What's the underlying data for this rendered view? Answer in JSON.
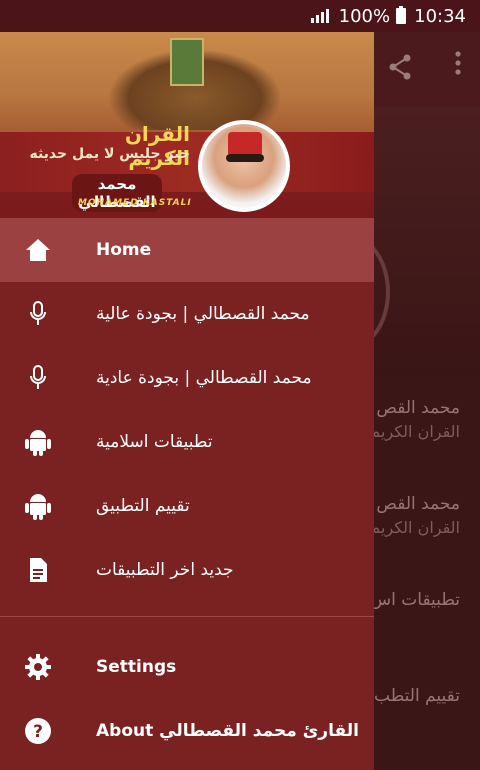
{
  "status_bar": {
    "battery": "100%",
    "time": "10:34"
  },
  "header": {
    "title": "القران الكريم",
    "subtitle": "خير جليس لا يمل حديثه",
    "name_ar": "محمد القصطالي",
    "name_en": "MOHAMED KASTALI"
  },
  "menu": [
    {
      "label": "Home",
      "icon": "home-icon",
      "active": true
    },
    {
      "label": "محمد القصطالي | بجودة عالية",
      "icon": "microphone-icon"
    },
    {
      "label": "محمد القصطالي | بجودة عادية",
      "icon": "microphone-icon"
    },
    {
      "label": "تطبيقات اسلامية",
      "icon": "android-icon"
    },
    {
      "label": "تقييم التطبيق",
      "icon": "android-icon"
    },
    {
      "label": "جديد اخر التطبيقات",
      "icon": "document-icon"
    }
  ],
  "menu_bottom": [
    {
      "label": "Settings",
      "icon": "gear-icon"
    },
    {
      "label": "About القارئ محمد القصطالي",
      "icon": "help-icon"
    }
  ],
  "background_app": {
    "items": [
      {
        "line1": "محمد القص",
        "line2": "القران الكريم"
      },
      {
        "line1": "محمد القص",
        "line2": "القران الكريم"
      },
      {
        "line1": "تطبيقات اس",
        "line2": ""
      },
      {
        "line1": "تقييم التطب",
        "line2": ""
      }
    ]
  },
  "colors": {
    "drawer": "#7a2222",
    "active": "#9b4141",
    "statusbar": "#4a1418"
  }
}
